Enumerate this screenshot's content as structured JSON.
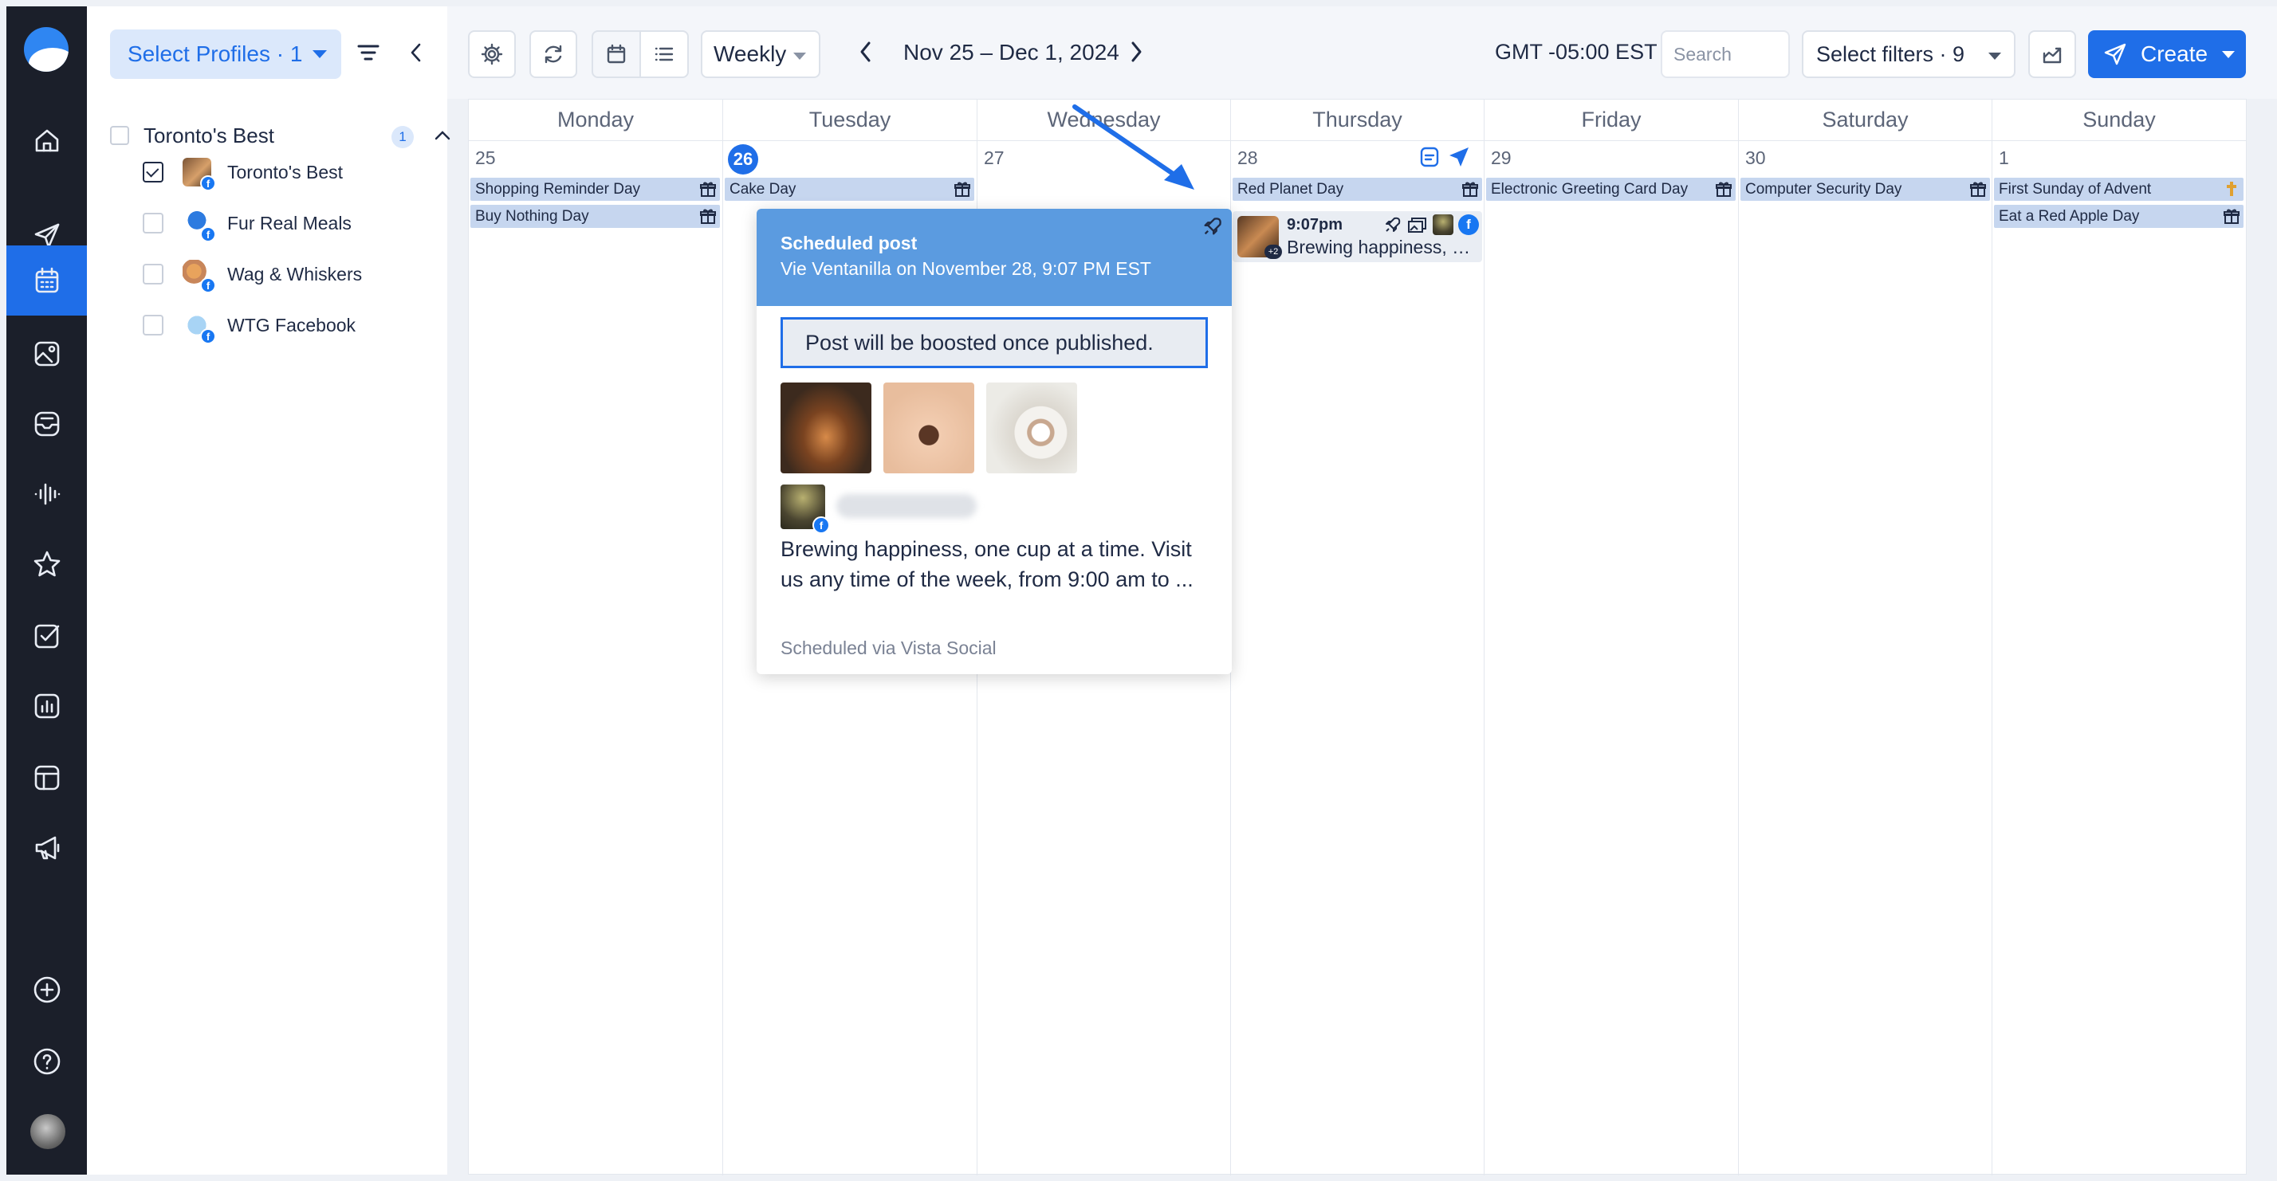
{
  "sidebar_rail": {
    "items": [
      {
        "name": "home-icon"
      },
      {
        "name": "send-icon"
      },
      {
        "name": "calendar-icon",
        "active": true
      },
      {
        "name": "media-library-icon"
      },
      {
        "name": "inbox-icon"
      },
      {
        "name": "listening-icon"
      },
      {
        "name": "star-icon"
      },
      {
        "name": "tasks-icon"
      },
      {
        "name": "reports-icon"
      },
      {
        "name": "layout-icon"
      },
      {
        "name": "megaphone-icon"
      },
      {
        "name": "add-icon"
      },
      {
        "name": "help-icon"
      }
    ]
  },
  "profiles_panel": {
    "select_label": "Select Profiles · 1",
    "group": {
      "name": "Toronto's Best",
      "count": "1"
    },
    "profiles": [
      {
        "name": "Toronto's Best",
        "checked": true
      },
      {
        "name": "Fur Real Meals",
        "checked": false
      },
      {
        "name": "Wag & Whiskers",
        "checked": false
      },
      {
        "name": "WTG Facebook",
        "checked": false
      }
    ]
  },
  "toolbar": {
    "view": "Weekly",
    "date_range": "Nov 25 – Dec 1, 2024",
    "timezone": "GMT -05:00 EST",
    "search_placeholder": "Search",
    "filters_label": "Select filters · 9",
    "create_label": "Create"
  },
  "calendar": {
    "days": [
      {
        "name": "Monday",
        "num": "25",
        "events": [
          "Shopping Reminder Day",
          "Buy Nothing Day"
        ]
      },
      {
        "name": "Tuesday",
        "num": "26",
        "today": true,
        "events": [
          "Cake Day"
        ]
      },
      {
        "name": "Wednesday",
        "num": "27",
        "events": []
      },
      {
        "name": "Thursday",
        "num": "28",
        "events": [
          "Red Planet Day"
        ]
      },
      {
        "name": "Friday",
        "num": "29",
        "events": [
          "Electronic Greeting Card Day"
        ]
      },
      {
        "name": "Saturday",
        "num": "30",
        "events": [
          "Computer Security Day"
        ]
      },
      {
        "name": "Sunday",
        "num": "1",
        "events": [
          "First Sunday of Advent",
          "Eat a Red Apple Day"
        ]
      }
    ],
    "post_card": {
      "time": "9:07pm",
      "text": "Brewing happiness, o...",
      "extra_count": "+2"
    }
  },
  "popup": {
    "title": "Scheduled post",
    "subtitle": "Vie Ventanilla on November 28, 9:07 PM EST",
    "boost_notice": "Post will be boosted once published.",
    "body": "Brewing happiness, one cup at a time. Visit us any time of the week, from 9:00 am to ...",
    "via": "Scheduled via Vista Social"
  },
  "colors": {
    "accent": "#1f6ee8",
    "rail": "#1b1f2a",
    "holiday": "#c6d6ef",
    "popup_header": "#5b9be0"
  }
}
